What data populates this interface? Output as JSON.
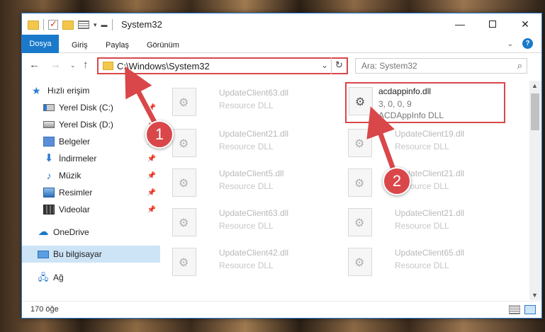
{
  "window": {
    "title": "System32"
  },
  "ribbon": {
    "tabs": [
      "Dosya",
      "Giriş",
      "Paylaş",
      "Görünüm"
    ]
  },
  "navigation": {
    "address_path": "C:\\Windows\\System32",
    "search_placeholder": "Ara: System32"
  },
  "sidebar": {
    "items": [
      {
        "label": "Hızlı erişim",
        "icon": "star-icon"
      },
      {
        "label": "Yerel Disk (C:)",
        "icon": "drive-icon"
      },
      {
        "label": "Yerel Disk (D:)",
        "icon": "drive-icon"
      },
      {
        "label": "Belgeler",
        "icon": "document-icon"
      },
      {
        "label": "İndirmeler",
        "icon": "download-icon"
      },
      {
        "label": "Müzik",
        "icon": "music-icon"
      },
      {
        "label": "Resimler",
        "icon": "pictures-icon"
      },
      {
        "label": "Videolar",
        "icon": "video-icon"
      },
      {
        "label": "OneDrive",
        "icon": "cloud-icon"
      },
      {
        "label": "Bu bilgisayar",
        "icon": "computer-icon"
      },
      {
        "label": "Ağ",
        "icon": "network-icon"
      }
    ]
  },
  "files": [
    {
      "name": "UpdateClient63.dll",
      "type": "Resource DLL"
    },
    {
      "name": "acdappinfo.dll",
      "version": "3, 0, 0, 9",
      "type": "ACDAppInfo DLL"
    },
    {
      "name": "UpdateClient21.dll",
      "type": "Resource DLL"
    },
    {
      "name": "UpdateClient19.dll",
      "type": "Resource DLL"
    },
    {
      "name": "UpdateClient5.dll",
      "type": "Resource DLL"
    },
    {
      "name": "UpdateClient21.dll",
      "type": "Resource DLL"
    },
    {
      "name": "UpdateClient63.dll",
      "type": "Resource DLL"
    },
    {
      "name": "UpdateClient21.dll",
      "type": "Resource DLL"
    },
    {
      "name": "UpdateClient42.dll",
      "type": "Resource DLL"
    },
    {
      "name": "UpdateClient65.dll",
      "type": "Resource DLL"
    }
  ],
  "status": {
    "item_count": "170 öğe"
  },
  "annotations": {
    "marker1": "1",
    "marker2": "2",
    "color": "#d9474a"
  }
}
